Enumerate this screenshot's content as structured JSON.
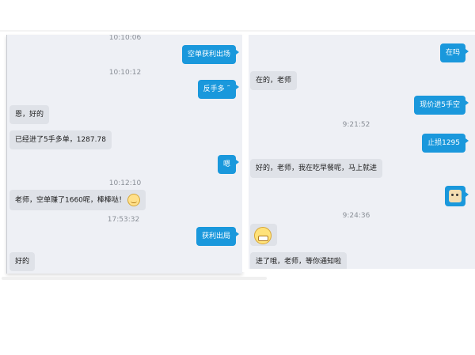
{
  "left_chat": {
    "messages": [
      {
        "type": "timestamp",
        "text": "10:10:06"
      },
      {
        "type": "out",
        "text": "空单获利出场"
      },
      {
        "type": "timestamp",
        "text": "10:10:12"
      },
      {
        "type": "out",
        "text": "反手多  ˜"
      },
      {
        "type": "in",
        "text": "恩，好的"
      },
      {
        "type": "in",
        "text": "已经进了5手多单，1287.78"
      },
      {
        "type": "out",
        "text": "嗯"
      },
      {
        "type": "timestamp",
        "text": "10:12:10"
      },
      {
        "type": "in",
        "text": "老师，空单赚了1660呢，棒棒哒！",
        "emoji": "smile-emoji"
      },
      {
        "type": "timestamp",
        "text": "17:53:32"
      },
      {
        "type": "out",
        "text": "获利出局"
      },
      {
        "type": "in",
        "text": "好的"
      }
    ]
  },
  "right_chat": {
    "messages": [
      {
        "type": "out",
        "text": "在吗"
      },
      {
        "type": "in",
        "text": "在的，老师"
      },
      {
        "type": "out",
        "text": "现价进5手空"
      },
      {
        "type": "timestamp",
        "text": "9:21:52"
      },
      {
        "type": "out",
        "text": "止损1295"
      },
      {
        "type": "in",
        "text": "好的，老师，我在吃早餐呢，马上就进"
      },
      {
        "type": "out_sticker",
        "icon": "cat-sticker"
      },
      {
        "type": "timestamp",
        "text": "9:24:36"
      },
      {
        "type": "in_sticker",
        "icon": "grin-sticker"
      },
      {
        "type": "in",
        "text": "进了哦，老师，等你通知啦"
      }
    ]
  },
  "colors": {
    "outgoing_bubble": "#1a98dc",
    "incoming_bubble": "#dfe2e8",
    "panel_background": "#eef0f5",
    "timestamp_text": "#8a8f97"
  }
}
